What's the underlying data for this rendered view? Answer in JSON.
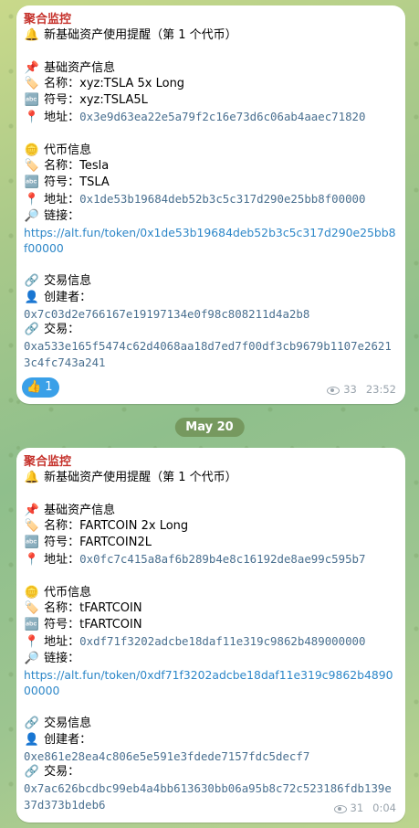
{
  "date_divider": "May 20",
  "messages": [
    {
      "sender": "聚合监控",
      "header": "新基础资产使用提醒（第 1 个代币）",
      "base_title": "基础资产信息",
      "base_name_label": "名称：",
      "base_name": "xyz:TSLA 5x Long",
      "base_symbol_label": "符号：",
      "base_symbol": "xyz:TSLA5L",
      "base_addr_label": "地址：",
      "base_addr": "0x3e9d63ea22e5a79f2c16e73d6c06ab4aaec71820",
      "token_title": "代币信息",
      "token_name_label": "名称：",
      "token_name": "Tesla",
      "token_symbol_label": "符号：",
      "token_symbol": "TSLA",
      "token_addr_label": "地址：",
      "token_addr": "0x1de53b19684deb52b3c5c317d290e25bb8f00000",
      "link_label": "链接：",
      "link": "https://alt.fun/token/0x1de53b19684deb52b3c5c317d290e25bb8f00000",
      "tx_title": "交易信息",
      "creator_label": "创建者：",
      "creator": "0x7c03d2e766167e19197134e0f98c808211d4a2b8",
      "tx_label": "交易：",
      "tx": "0xa533e165f5474c62d4068aa18d7ed7f00df3cb9679b1107e26213c4fc743a241",
      "reaction_count": "1",
      "views": "33",
      "time": "23:52"
    },
    {
      "sender": "聚合监控",
      "header": "新基础资产使用提醒（第 1 个代币）",
      "base_title": "基础资产信息",
      "base_name_label": "名称：",
      "base_name": "FARTCOIN 2x Long",
      "base_symbol_label": "符号：",
      "base_symbol": "FARTCOIN2L",
      "base_addr_label": "地址：",
      "base_addr": "0x0fc7c415a8af6b289b4e8c16192de8ae99c595b7",
      "token_title": "代币信息",
      "token_name_label": "名称：",
      "token_name": "tFARTCOIN",
      "token_symbol_label": "符号：",
      "token_symbol": "tFARTCOIN",
      "token_addr_label": "地址：",
      "token_addr": "0xdf71f3202adcbe18daf11e319c9862b489000000",
      "link_label": "链接：",
      "link": "https://alt.fun/token/0xdf71f3202adcbe18daf11e319c9862b489000000",
      "tx_title": "交易信息",
      "creator_label": "创建者：",
      "creator": "0xe861e28ea4c806e5e591e3fdede7157fdc5decf7",
      "tx_label": "交易：",
      "tx": "0x7ac626bcdbc99eb4a4bb613630bb06a95b8c72c523186fdb139e37d373b1deb6",
      "views": "31",
      "time": "0:04"
    }
  ]
}
